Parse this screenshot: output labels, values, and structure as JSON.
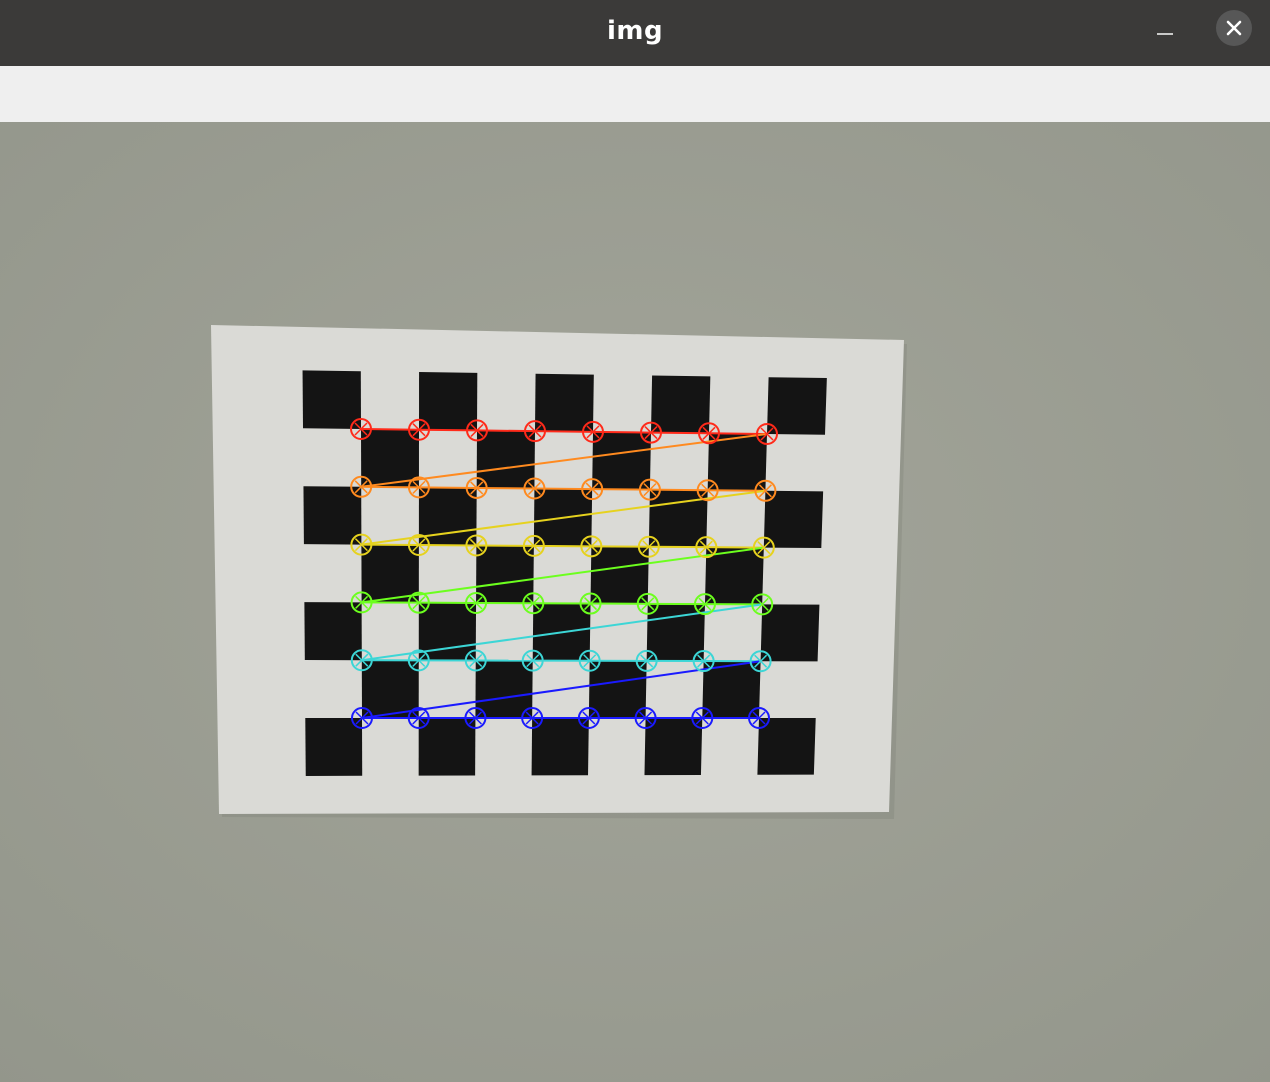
{
  "window": {
    "title": "img"
  },
  "icons": {
    "minimize": "minimize-icon",
    "close": "close-icon"
  },
  "image": {
    "content": "chessboard-calibration-pattern",
    "detected_corners": {
      "cols": 8,
      "rows": 6,
      "row_colors": [
        "#ff2a1a",
        "#ff8a1f",
        "#e6d21e",
        "#6cff1e",
        "#3cd6d6",
        "#1a1aff"
      ]
    },
    "colors": {
      "wall": "#9c9e93",
      "paper": "#dcdcd8",
      "squares": "#141414"
    }
  }
}
